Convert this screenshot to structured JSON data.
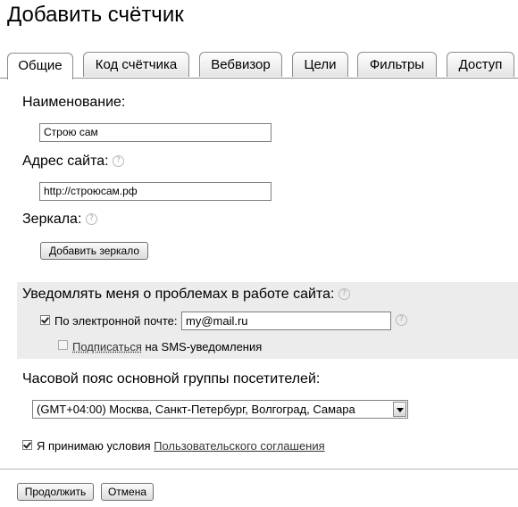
{
  "page": {
    "title": "Добавить счётчик"
  },
  "tabs": [
    {
      "label": "Общие",
      "active": true
    },
    {
      "label": "Код счётчика"
    },
    {
      "label": "Вебвизор"
    },
    {
      "label": "Цели"
    },
    {
      "label": "Фильтры"
    },
    {
      "label": "Доступ"
    }
  ],
  "form": {
    "name_label": "Наименование:",
    "name_value": "Строю сам",
    "site_label": "Адрес сайта:",
    "site_value": "http://строюсам.рф",
    "mirrors_label": "Зеркала:",
    "add_mirror_button": "Добавить зеркало",
    "help_glyph": "?"
  },
  "notify": {
    "heading": "Уведомлять меня о проблемах в работе сайта:",
    "email_checkbox_label": "По электронной почте:",
    "email_checked": true,
    "email_value": "my@mail.ru",
    "sms_link": "Подписаться",
    "sms_suffix": " на SMS-уведомления",
    "sms_checked": false
  },
  "timezone": {
    "label": "Часовой пояс основной группы посетителей:",
    "selected": "(GMT+04:00) Москва, Санкт-Петербург, Волгоград, Самара"
  },
  "agreement": {
    "checked": true,
    "text": "Я принимаю условия ",
    "link": "Пользовательского соглашения"
  },
  "buttons": {
    "continue": "Продолжить",
    "cancel": "Отмена"
  }
}
